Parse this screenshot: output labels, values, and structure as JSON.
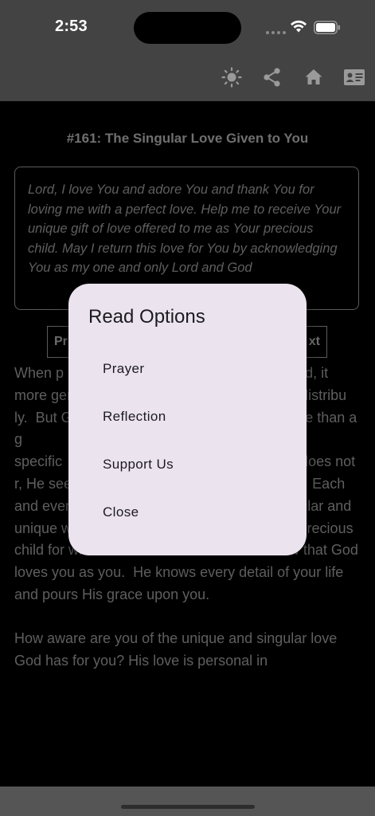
{
  "status_bar": {
    "time": "2:53"
  },
  "app_bar": {
    "icons": [
      "brightness-icon",
      "share-icon",
      "home-icon",
      "contact-card-icon"
    ]
  },
  "content": {
    "title": "#161: The Singular Love Given to You",
    "prayer_text": "Lord, I love You and adore You and thank You for loving me with a perfect love.  Help me to receive Your unique gift of love offered to me as Your precious child.  May I return this love for You by acknowledging You as my one and only Lord and God",
    "prev_label": "Pr",
    "next_label": "xt",
    "reflection": [
      "When p                                                 y of God, it                                               more general                                           enly distribu                                           ly.  But God's lo                                       h more than a g                                        eeply persona                                                  specific                                                    God does not                                          r, He sees you as a singular focus of His love.  Each and every person is loved by God in this singular and unique way.  Thus, you are loved as His one precious child for whom He has offered His life.  Know that God loves you as you.  He knows every detail of your life and pours His grace upon you.",
      "How aware are you of the unique and singular love God has for you?  His love is personal in"
    ]
  },
  "dialog": {
    "title": "Read Options",
    "options": [
      "Prayer",
      "Reflection",
      "Support Us",
      "Close"
    ]
  },
  "colors": {
    "app_bar": "#434343",
    "dialog_bg": "#ebe4ef",
    "page_bg": "#000000"
  }
}
